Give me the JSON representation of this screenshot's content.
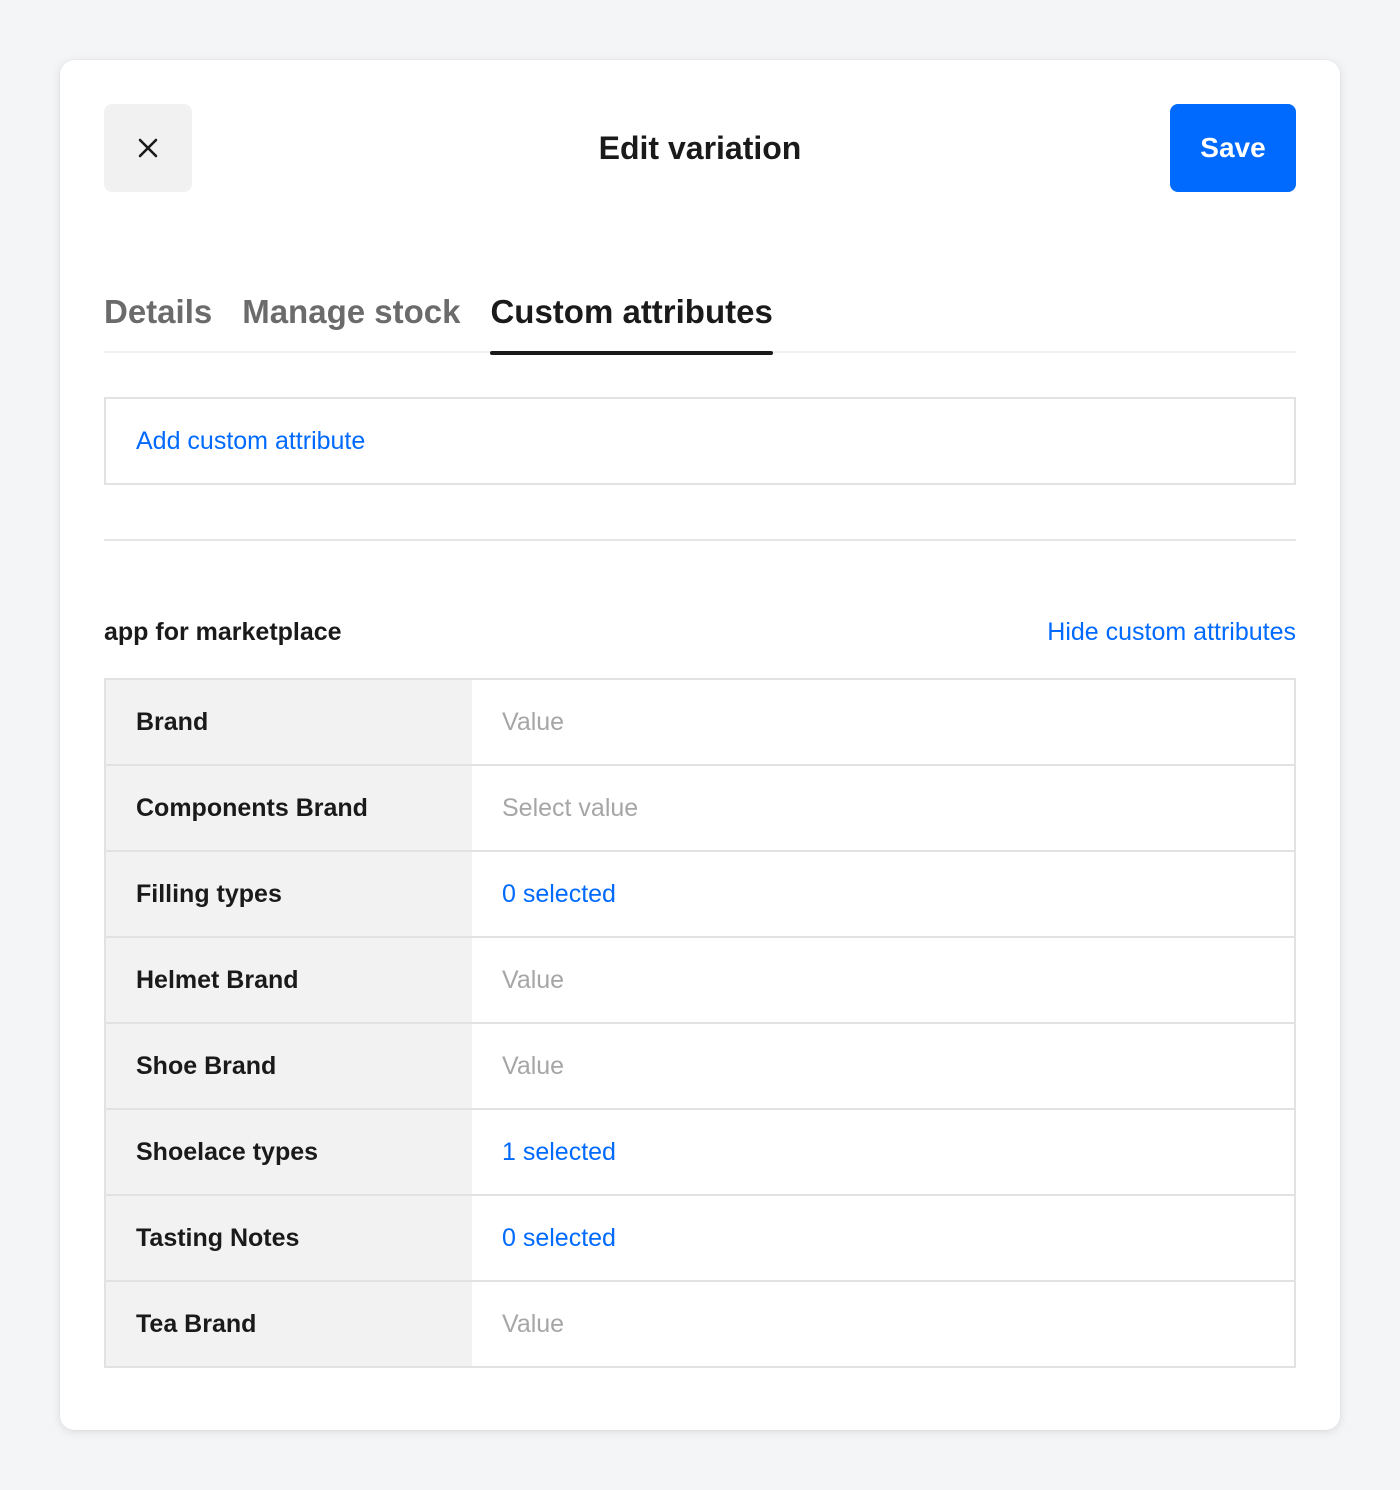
{
  "header": {
    "title": "Edit variation",
    "save_label": "Save"
  },
  "tabs": [
    {
      "label": "Details",
      "active": false
    },
    {
      "label": "Manage stock",
      "active": false
    },
    {
      "label": "Custom attributes",
      "active": true
    }
  ],
  "add_attribute_label": "Add custom attribute",
  "section": {
    "title": "app for marketplace",
    "hide_label": "Hide custom attributes"
  },
  "attributes": [
    {
      "label": "Brand",
      "value": "Value",
      "kind": "placeholder"
    },
    {
      "label": "Components Brand",
      "value": "Select value",
      "kind": "placeholder"
    },
    {
      "label": "Filling types",
      "value": "0 selected",
      "kind": "link"
    },
    {
      "label": "Helmet Brand",
      "value": "Value",
      "kind": "placeholder"
    },
    {
      "label": "Shoe Brand",
      "value": "Value",
      "kind": "placeholder"
    },
    {
      "label": "Shoelace types",
      "value": "1 selected",
      "kind": "link"
    },
    {
      "label": "Tasting Notes",
      "value": "0 selected",
      "kind": "link"
    },
    {
      "label": "Tea Brand",
      "value": "Value",
      "kind": "placeholder"
    }
  ],
  "colors": {
    "accent": "#006aff",
    "label_bg": "#f2f2f2",
    "placeholder": "#a6a6a6"
  },
  "icons": {
    "close": "close-icon"
  }
}
